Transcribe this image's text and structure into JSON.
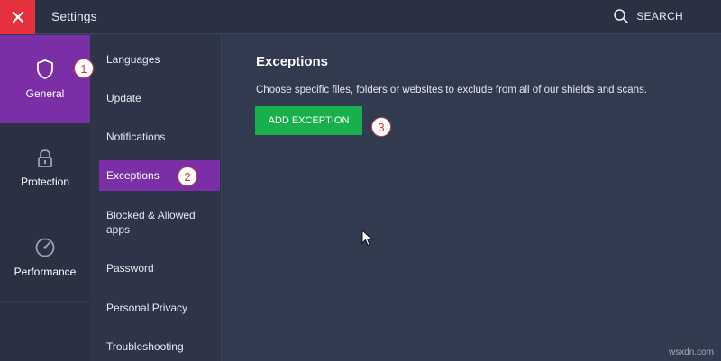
{
  "window": {
    "title": "Settings",
    "close_icon": "close-icon",
    "search_label": "SEARCH",
    "search_icon": "search-icon",
    "accent_color": "#7b2fa6",
    "close_color": "#e5303e"
  },
  "mainnav": {
    "items": [
      {
        "label": "General",
        "icon": "shield-icon",
        "active": true
      },
      {
        "label": "Protection",
        "icon": "lock-icon",
        "active": false
      },
      {
        "label": "Performance",
        "icon": "gauge-icon",
        "active": false
      }
    ]
  },
  "subnav": {
    "items": [
      {
        "label": "Languages"
      },
      {
        "label": "Update"
      },
      {
        "label": "Notifications"
      },
      {
        "label": "Exceptions",
        "active": true
      },
      {
        "label": "Blocked & Allowed apps"
      },
      {
        "label": "Password"
      },
      {
        "label": "Personal Privacy"
      },
      {
        "label": "Troubleshooting"
      }
    ]
  },
  "content": {
    "heading": "Exceptions",
    "description": "Choose specific files, folders or websites to exclude from all of our shields and scans.",
    "add_button_label": "ADD EXCEPTION",
    "add_button_color": "#19b04b"
  },
  "markers": [
    "1",
    "2",
    "3"
  ],
  "watermark": "wsxdn.com"
}
